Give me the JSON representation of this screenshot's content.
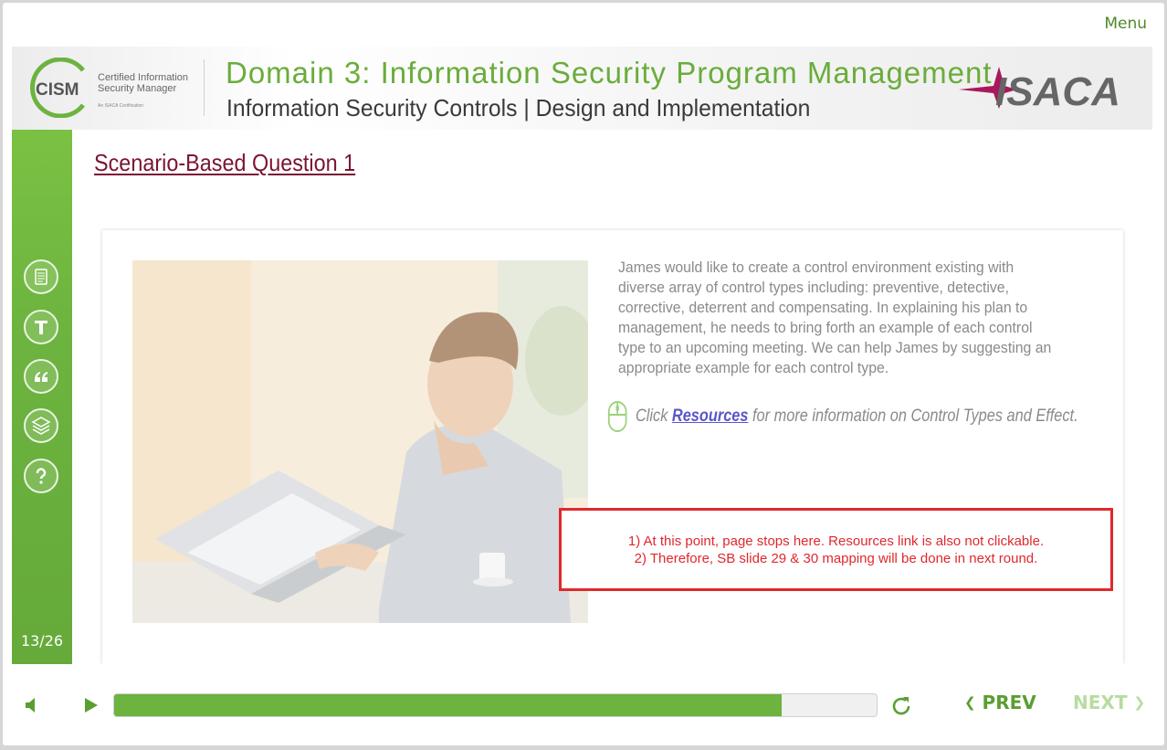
{
  "menu_label": "Menu",
  "header": {
    "cism_abbr": "CISM",
    "cism_line1": "Certified Information",
    "cism_line2": "Security Manager",
    "cism_tagline": "An ISACA Certification",
    "domain_title": "Domain 3: Information Security Program Management",
    "domain_subtitle": "Information Security Controls | Design and Implementation",
    "isaca_logo": "ISACA"
  },
  "sidebar": {
    "icons": [
      "notes-icon",
      "transcript-icon",
      "glossary-icon",
      "resources-icon",
      "help-icon"
    ],
    "page_counter": "13/26"
  },
  "content": {
    "question_title": "Scenario-Based Question 1",
    "scenario_text": "James would like to create a control environment existing with diverse array of control types including: preventive, detective, corrective, deterrent and compensating. In explaining his plan to management, he needs to bring forth an example of each control type to an upcoming meeting. We can help James by suggesting an appropriate example for each control type.",
    "resource_prefix": "Click ",
    "resource_link": "Resources",
    "resource_suffix": " for more information on Control Types and Effect."
  },
  "annotation": {
    "line1": "1) At this point, page stops here. Resources link is also not clickable.",
    "line2": "2) Therefore, SB slide 29 & 30 mapping will be done in next round."
  },
  "player": {
    "progress_fraction": 0.876,
    "prev_label": "PREV",
    "next_label": "NEXT"
  },
  "colors": {
    "brand_green": "#6cb33f",
    "title_maroon": "#7a1533",
    "annotation_red": "#e0282d",
    "link_blue": "#5a57c9"
  }
}
